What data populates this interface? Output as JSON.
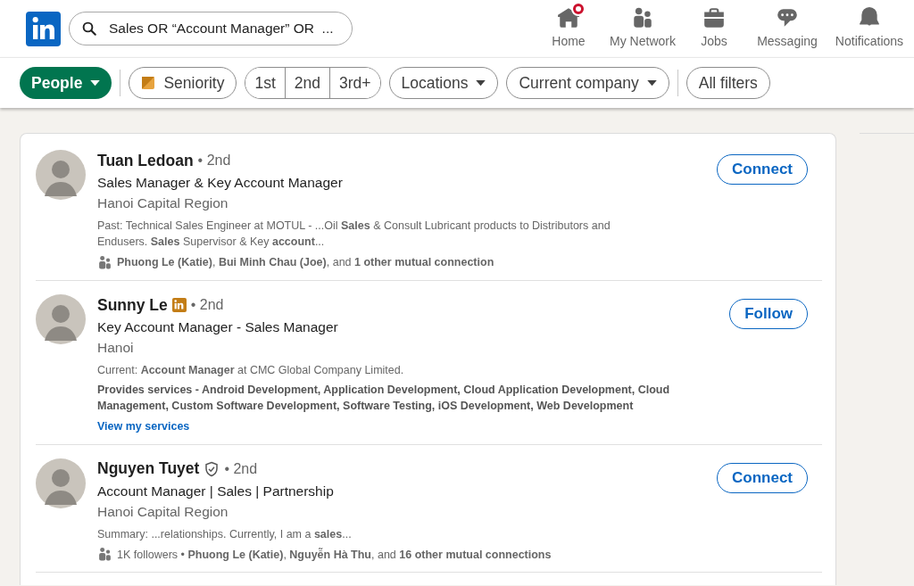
{
  "search": {
    "value": "Sales OR “Account Manager” OR  ..."
  },
  "nav": [
    {
      "kind": "home",
      "label": "Home",
      "notification_dot": true
    },
    {
      "kind": "network",
      "label": "My Network",
      "notification_dot": false
    },
    {
      "kind": "jobs",
      "label": "Jobs",
      "notification_dot": false
    },
    {
      "kind": "messaging",
      "label": "Messaging",
      "notification_dot": false
    },
    {
      "kind": "notifications",
      "label": "Notifications",
      "notification_dot": false
    }
  ],
  "filters": [
    {
      "kind": "dropdown",
      "label": "People",
      "selected": true
    },
    {
      "kind": "divider"
    },
    {
      "kind": "icon",
      "label": "Seniority",
      "selected": false
    },
    {
      "kind": "segmented",
      "options": [
        {
          "label": "1st",
          "selected": false
        },
        {
          "label": "2nd",
          "selected": false
        },
        {
          "label": "3rd+",
          "selected": false
        }
      ]
    },
    {
      "kind": "dropdown",
      "label": "Locations",
      "selected": false
    },
    {
      "kind": "dropdown",
      "label": "Current company",
      "selected": false
    },
    {
      "kind": "divider"
    },
    {
      "kind": "plain",
      "label": "All filters",
      "selected": false
    }
  ],
  "results": [
    {
      "name": "Tuan Ledoan",
      "premium": false,
      "verified": false,
      "degree": "• 2nd",
      "headline": "Sales Manager & Key Account Manager",
      "location": "Hanoi Capital Region",
      "action": "Connect",
      "lines": [
        {
          "kind": "snippet",
          "text": "Past: Technical Sales Engineer at MOTUL - ...Oil **Sales** & Consult Lubricant products to Distributors and Endusers. **Sales** Supervisor & Key **account**..."
        },
        {
          "kind": "mutual",
          "text": "**Phuong Le (Katie)**, **Bui Minh Chau (Joe)**, and **1 other mutual connection**"
        }
      ]
    },
    {
      "name": "Sunny Le",
      "premium": true,
      "verified": false,
      "degree": "• 2nd",
      "headline": "Key Account Manager - Sales Manager",
      "location": "Hanoi",
      "action": "Follow",
      "lines": [
        {
          "kind": "snippet",
          "text": "Current: **Account Manager** at CMC Global Company Limited."
        },
        {
          "kind": "services",
          "text": "Provides services - Android Development, Application Development, Cloud Application Development, Cloud Management, Custom Software Development, Software Testing, iOS Development, Web Development"
        },
        {
          "kind": "link",
          "text": "View my services"
        }
      ]
    },
    {
      "name": "Nguyen Tuyet",
      "premium": false,
      "verified": true,
      "degree": "• 2nd",
      "headline": "Account Manager | Sales | Partnership",
      "location": "Hanoi Capital Region",
      "action": "Connect",
      "lines": [
        {
          "kind": "snippet",
          "text": "Summary: ...relationships. Currently, I am a **sales**..."
        },
        {
          "kind": "mutual",
          "text": "1K followers • **Phuong Le (Katie)**, **Nguyễn Hà Thu**, and **16 other mutual connections**"
        }
      ]
    }
  ]
}
